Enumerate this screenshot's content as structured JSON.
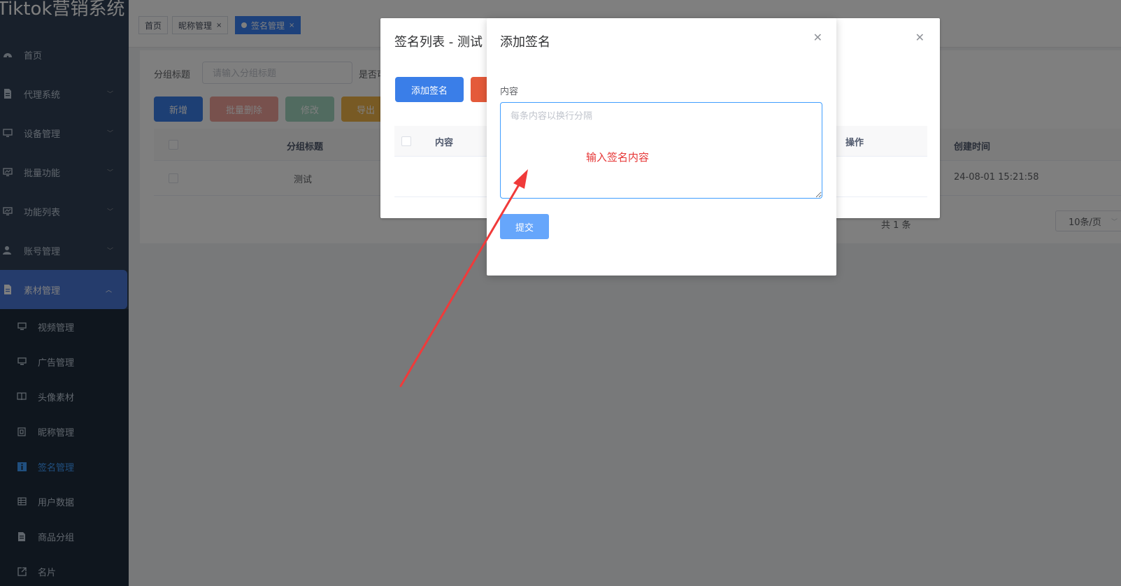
{
  "app": {
    "title": "Tiktok营销系统"
  },
  "sidebar": {
    "items": [
      {
        "label": "首页",
        "icon": "dashboard-icon",
        "expandable": false
      },
      {
        "label": "代理系统",
        "icon": "document-icon",
        "expandable": true
      },
      {
        "label": "设备管理",
        "icon": "monitor-icon",
        "expandable": true
      },
      {
        "label": "批量功能",
        "icon": "monitor-icon",
        "expandable": true
      },
      {
        "label": "功能列表",
        "icon": "monitor-icon",
        "expandable": true
      },
      {
        "label": "账号管理",
        "icon": "user-icon",
        "expandable": true
      },
      {
        "label": "素材管理",
        "icon": "document-icon",
        "expandable": true,
        "open": true
      }
    ],
    "subitems": [
      {
        "label": "视频管理",
        "icon": "monitor-icon"
      },
      {
        "label": "广告管理",
        "icon": "monitor-icon"
      },
      {
        "label": "头像素材",
        "icon": "book-icon"
      },
      {
        "label": "昵称管理",
        "icon": "qrcode-icon"
      },
      {
        "label": "签名管理",
        "icon": "info-icon",
        "active": true
      },
      {
        "label": "用户数据",
        "icon": "table-icon"
      },
      {
        "label": "商品分组",
        "icon": "list-icon"
      },
      {
        "label": "名片",
        "icon": "external-link-icon"
      }
    ]
  },
  "tabs": [
    {
      "label": "首页"
    },
    {
      "label": "昵称管理",
      "close": "×"
    },
    {
      "label": "签名管理",
      "close": "×",
      "active": true
    }
  ],
  "filter": {
    "group_title_label": "分组标题",
    "group_title_placeholder": "请输入分组标题",
    "second_label": "是否可"
  },
  "toolbar": {
    "add": "新增",
    "batch_delete": "批量删除",
    "edit": "修改",
    "export": "导出"
  },
  "table": {
    "columns": {
      "group_title": "分组标题",
      "created_time": "创建时间"
    },
    "rows": [
      {
        "group_title": "测试",
        "created_time": "24-08-01 15:21:58"
      }
    ]
  },
  "pager": {
    "total": "共 1 条",
    "page_size": "10条/页"
  },
  "signature_list_dialog": {
    "title": "签名列表 - 测试",
    "add_button": "添加签名",
    "columns": {
      "content": "内容",
      "operation": "操作"
    }
  },
  "add_signature_dialog": {
    "title": "添加签名",
    "content_label": "内容",
    "content_placeholder": "每条内容以换行分隔",
    "annotation": "输入签名内容",
    "submit": "提交"
  },
  "colors": {
    "sidebar_bg": "#304156",
    "accent": "#409eff",
    "annotation": "#e63535"
  }
}
